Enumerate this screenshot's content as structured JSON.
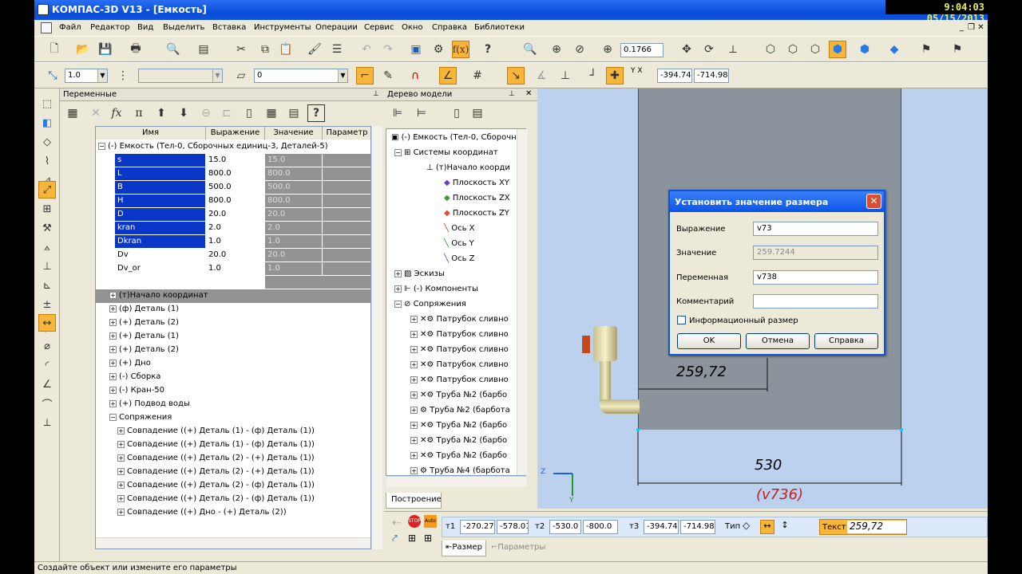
{
  "window": {
    "title": "КОМПАС-3D V13 - [Емкость]"
  },
  "clock": {
    "text": "9:04:03  05/15/2013"
  },
  "menu": [
    "Файл",
    "Редактор",
    "Вид",
    "Выделить",
    "Вставка",
    "Инструменты",
    "Операции",
    "Сервис",
    "Окно",
    "Справка",
    "Библиотеки"
  ],
  "toolbar": {
    "zoom_value": "0.1766",
    "line_scale": "1.0",
    "layer_value": "0",
    "coord_label": "Y X",
    "coord_x": "-394.74",
    "coord_y": "-714.98"
  },
  "variables_panel": {
    "title": "Переменные",
    "columns": [
      "Имя",
      "Выражение",
      "Значение",
      "Параметр"
    ],
    "root": "(-) Емкость (Тел-0, Сборочных единиц-3, Деталей-5)",
    "rows": [
      {
        "name": "s",
        "expr": "15.0",
        "value": "15.0"
      },
      {
        "name": "L",
        "expr": "800.0",
        "value": "800.0"
      },
      {
        "name": "B",
        "expr": "500.0",
        "value": "500.0"
      },
      {
        "name": "H",
        "expr": "800.0",
        "value": "800.0"
      },
      {
        "name": "D",
        "expr": "20.0",
        "value": "20.0"
      },
      {
        "name": "kran",
        "expr": "2.0",
        "value": "2.0"
      },
      {
        "name": "Dkran",
        "expr": "1.0",
        "value": "1.0"
      },
      {
        "name": "Dv",
        "expr": "20.0",
        "value": "20.0"
      },
      {
        "name": "Dv_or",
        "expr": "1.0",
        "value": "1.0"
      }
    ],
    "groups": [
      "(т)Начало координат",
      "(ф) Деталь (1)",
      "(+) Деталь (2)",
      "(+) Деталь (1)",
      "(+) Деталь (2)",
      "(+) Дно",
      "(-) Сборка",
      "(-) Кран-50",
      "(+) Подвод воды",
      "Сопряжения"
    ],
    "mates": [
      "Совпадение ((+) Деталь (1) - (ф) Деталь (1))",
      "Совпадение ((+) Деталь (1) - (ф) Деталь (1))",
      "Совпадение ((+) Деталь (2) - (+) Деталь (1))",
      "Совпадение ((+) Деталь (2) - (+) Деталь (1))",
      "Совпадение ((+) Деталь (2) - (ф) Деталь (1))",
      "Совпадение ((+) Деталь (2) - (ф) Деталь (1))",
      "Совпадение ((+) Дно - (+) Деталь (2))"
    ]
  },
  "tree_panel": {
    "title": "Дерево модели",
    "items": [
      {
        "label": "(-) Емкость (Тел-0, Сборочны",
        "indent": 0
      },
      {
        "label": "Системы координат",
        "indent": 1
      },
      {
        "label": "(т)Начало коорди",
        "indent": 2
      },
      {
        "label": "Плоскость XY",
        "indent": 3
      },
      {
        "label": "Плоскость ZX",
        "indent": 3
      },
      {
        "label": "Плоскость ZY",
        "indent": 3
      },
      {
        "label": "Ось X",
        "indent": 3
      },
      {
        "label": "Ось Y",
        "indent": 3
      },
      {
        "label": "Ось Z",
        "indent": 3
      },
      {
        "label": "Эскизы",
        "indent": 1
      },
      {
        "label": "(-) Компоненты",
        "indent": 1
      },
      {
        "label": "Сопряжения",
        "indent": 1
      },
      {
        "label": "Патрубок сливно",
        "indent": 2
      },
      {
        "label": "Патрубок сливно",
        "indent": 2
      },
      {
        "label": "Патрубок сливно",
        "indent": 2
      },
      {
        "label": "Патрубок сливно",
        "indent": 2
      },
      {
        "label": "Патрубок сливно",
        "indent": 2
      },
      {
        "label": "Труба №2 (барбо",
        "indent": 2
      },
      {
        "label": "Труба №2 (барбота",
        "indent": 2
      },
      {
        "label": "Труба №2 (барбо",
        "indent": 2
      },
      {
        "label": "Труба №2 (барбо",
        "indent": 2
      },
      {
        "label": "Труба №2 (барбо",
        "indent": 2
      },
      {
        "label": "Труба №4 (барбота",
        "indent": 2
      }
    ],
    "tab": "Построение"
  },
  "canvas": {
    "dim1": "259,72",
    "dim2": "530",
    "dim2_var": "(v736)",
    "axis_z": "Z",
    "axis_y": "Y"
  },
  "dialog": {
    "title": "Установить значение размера",
    "expr_label": "Выражение",
    "expr_value": "v73",
    "value_label": "Значение",
    "value_value": "259.7244",
    "var_label": "Переменная",
    "var_value": "v738",
    "comment_label": "Комментарий",
    "comment_value": "",
    "info_label": "Информационный размер",
    "ok": "OK",
    "cancel": "Отмена",
    "help": "Справка"
  },
  "propbar": {
    "t1_label": "т1",
    "t1_x": "-270.27",
    "t1_y": "-578.01",
    "t2_label": "т2",
    "t2_x": "-530.0",
    "t2_y": "-800.0",
    "t3_label": "т3",
    "t3_x": "-394.74",
    "t3_y": "-714.98",
    "type_label": "Тип",
    "text_label": "Текст",
    "text_value": "259,72",
    "tab_size": "Размер",
    "tab_params": "Параметры"
  },
  "status": "Создайте объект или измените его параметры"
}
